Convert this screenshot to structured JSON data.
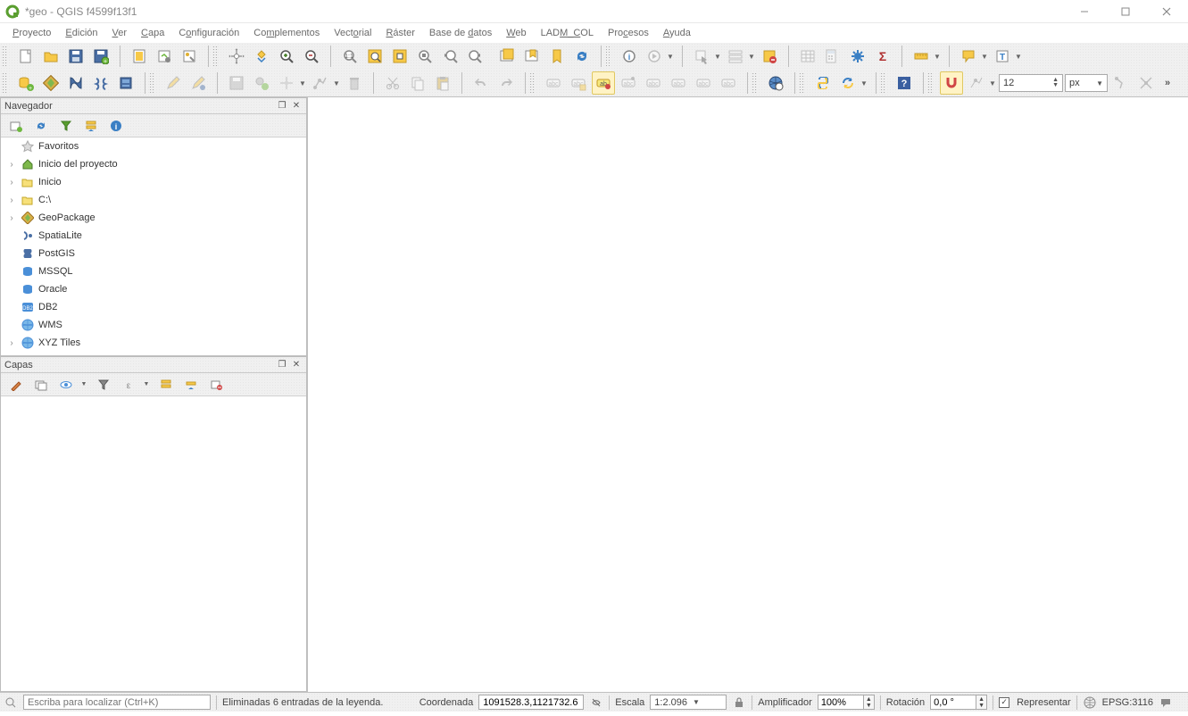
{
  "window": {
    "title": "*geo - QGIS f4599f13f1"
  },
  "menu": [
    "Proyecto",
    "Edición",
    "Ver",
    "Capa",
    "Configuración",
    "Complementos",
    "Vectorial",
    "Ráster",
    "Base de datos",
    "Web",
    "LADM_COL",
    "Procesos",
    "Ayuda"
  ],
  "toolbar_value": {
    "size_value": "12",
    "size_unit": "px"
  },
  "browser": {
    "title": "Navegador",
    "items": [
      {
        "label": "Favoritos",
        "expander": ""
      },
      {
        "label": "Inicio del proyecto",
        "expander": "›"
      },
      {
        "label": "Inicio",
        "expander": "›"
      },
      {
        "label": "C:\\",
        "expander": "›"
      },
      {
        "label": "GeoPackage",
        "expander": "›"
      },
      {
        "label": "SpatiaLite",
        "expander": ""
      },
      {
        "label": "PostGIS",
        "expander": ""
      },
      {
        "label": "MSSQL",
        "expander": ""
      },
      {
        "label": "Oracle",
        "expander": ""
      },
      {
        "label": "DB2",
        "expander": ""
      },
      {
        "label": "WMS",
        "expander": ""
      },
      {
        "label": "XYZ Tiles",
        "expander": "›"
      }
    ]
  },
  "layers": {
    "title": "Capas"
  },
  "statusbar": {
    "search_placeholder": "Escriba para localizar (Ctrl+K)",
    "message": "Eliminadas 6 entradas de la leyenda.",
    "coord_label": "Coordenada",
    "coord_value": "1091528.3,1121732.6",
    "scale_label": "Escala",
    "scale_value": "1:2.096",
    "amp_label": "Amplificador",
    "amp_value": "100%",
    "rot_label": "Rotación",
    "rot_value": "0,0 °",
    "render_label": "Representar",
    "epsg": "EPSG:3116"
  }
}
